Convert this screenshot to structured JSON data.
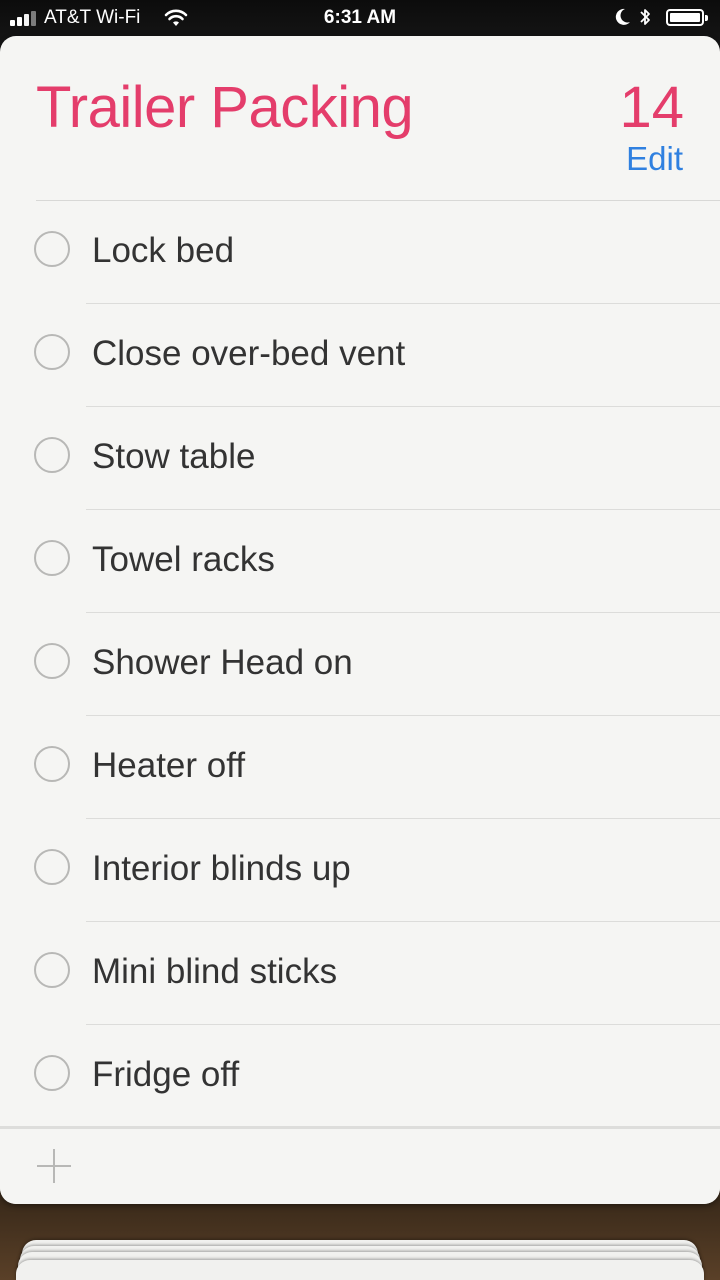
{
  "status_bar": {
    "carrier": "AT&T Wi-Fi",
    "time": "6:31 AM",
    "icons": [
      "signal-icon",
      "wifi-icon",
      "moon-icon",
      "bluetooth-icon",
      "battery-icon"
    ]
  },
  "list": {
    "title": "Trailer Packing",
    "count": "14",
    "edit_label": "Edit",
    "accent_color": "#e43d6b",
    "link_color": "#2f80e0",
    "items": [
      {
        "label": "Lock bed",
        "completed": false
      },
      {
        "label": "Close over-bed vent",
        "completed": false
      },
      {
        "label": "Stow table",
        "completed": false
      },
      {
        "label": "Towel racks",
        "completed": false
      },
      {
        "label": "Shower Head on",
        "completed": false
      },
      {
        "label": "Heater off",
        "completed": false
      },
      {
        "label": "Interior blinds up",
        "completed": false
      },
      {
        "label": "Mini blind sticks",
        "completed": false
      },
      {
        "label": "Fridge off",
        "completed": false
      }
    ]
  },
  "footer": {
    "add_icon": "plus-icon"
  }
}
